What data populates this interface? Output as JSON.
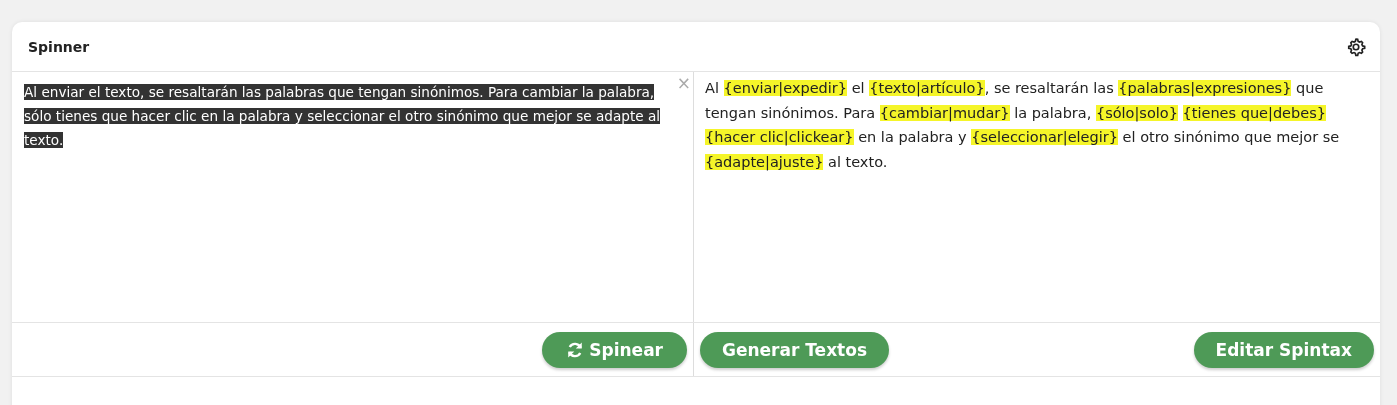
{
  "card": {
    "title": "Spinner"
  },
  "input": {
    "text": "Al enviar el texto, se resaltarán las palabras que tengan sinónimos. Para cambiar la palabra, sólo tienes que hacer clic en la palabra y seleccionar el otro sinónimo que mejor se adapte al texto.",
    "selected": true,
    "clear": "×"
  },
  "output": {
    "segments": [
      {
        "kind": "plain",
        "text": "Al "
      },
      {
        "kind": "synonyms",
        "text": "{enviar|expedir}"
      },
      {
        "kind": "plain",
        "text": " el "
      },
      {
        "kind": "synonyms",
        "text": "{texto|artículo}"
      },
      {
        "kind": "plain",
        "text": ", se resaltarán las "
      },
      {
        "kind": "synonyms",
        "text": "{palabras|expresiones}"
      },
      {
        "kind": "plain",
        "text": " que tengan sinónimos. Para "
      },
      {
        "kind": "synonyms",
        "text": "{cambiar|mudar}"
      },
      {
        "kind": "plain",
        "text": " la palabra, "
      },
      {
        "kind": "synonyms",
        "text": "{sólo|solo}"
      },
      {
        "kind": "synonyms",
        "text": "{tienes que|debes}"
      },
      {
        "kind": "synonyms",
        "text": "{hacer clic|clickear}"
      },
      {
        "kind": "plain",
        "text": " en la palabra y "
      },
      {
        "kind": "synonyms",
        "text": "{seleccionar|elegir}"
      },
      {
        "kind": "plain",
        "text": " el otro sinónimo que mejor se "
      },
      {
        "kind": "synonyms",
        "text": "{adapte|ajuste}"
      },
      {
        "kind": "plain",
        "text": " al texto."
      }
    ]
  },
  "buttons": {
    "spin": "Spinear",
    "generate": "Generar Textos",
    "edit": "Editar Spintax"
  }
}
